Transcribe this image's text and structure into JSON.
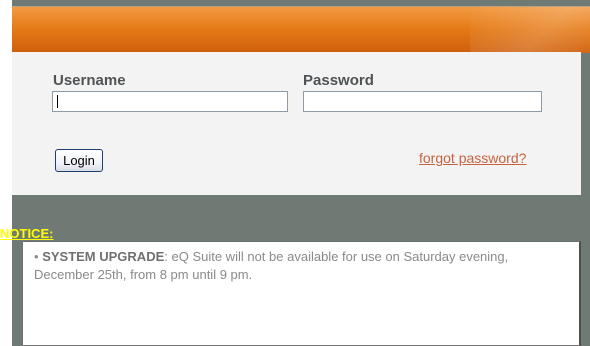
{
  "login": {
    "username_label": "Username",
    "password_label": "Password",
    "login_label": "Login",
    "forgot_password_label": "forgot password?"
  },
  "notice": {
    "heading": "NOTICE:",
    "bullet": "•",
    "title": "SYSTEM UPGRADE",
    "message": ": eQ Suite will not be available for use on Saturday evening, December 25th, from 8 pm until 9 pm."
  },
  "colors": {
    "header_orange": "#e57a16",
    "frame_gray": "#707a74",
    "notice_yellow": "#ffff00",
    "link_color": "#c7633f"
  }
}
